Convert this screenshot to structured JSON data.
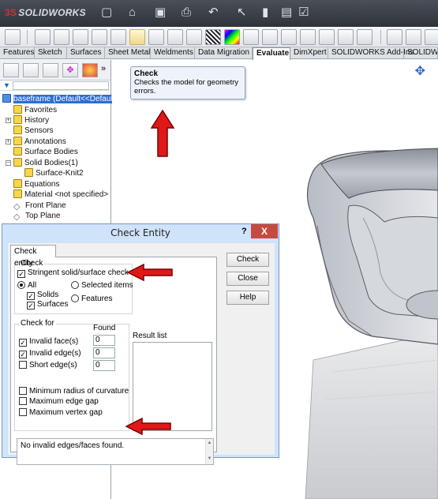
{
  "app": {
    "logo_text": "SOLIDWORKS",
    "logo_prefix": "3S"
  },
  "tabs": [
    "Features",
    "Sketch",
    "Surfaces",
    "Sheet Metal",
    "Weldments",
    "Data Migration",
    "Evaluate",
    "DimXpert",
    "SOLIDWORKS Add-Ins",
    "SOLIDWOR"
  ],
  "active_tab": "Evaluate",
  "tooltip": {
    "title": "Check",
    "body": "Checks the model for geometry errors."
  },
  "tree": {
    "root": "baseframe  (Default<<Default>",
    "items": [
      {
        "label": "Favorites"
      },
      {
        "label": "History"
      },
      {
        "label": "Sensors"
      },
      {
        "label": "Annotations"
      },
      {
        "label": "Surface Bodies"
      },
      {
        "label": "Solid Bodies(1)"
      },
      {
        "label": "Surface-Knit2"
      },
      {
        "label": "Equations"
      },
      {
        "label": "Material <not specified>"
      },
      {
        "label": "Front Plane"
      },
      {
        "label": "Top Plane"
      }
    ]
  },
  "dialog": {
    "title": "Check Entity",
    "help": "?",
    "close": "X",
    "tab_label": "Check entity",
    "check_group": "Check",
    "stringent": "Stringent solid/surface check",
    "all": "All",
    "selected_items": "Selected items",
    "solids": "Solids",
    "surfaces": "Surfaces",
    "features": "Features",
    "check_for_group": "Check for",
    "found_header": "Found",
    "invalid_faces": "Invalid face(s)",
    "invalid_edges": "Invalid edge(s)",
    "short_edges": "Short edge(s)",
    "invalid_faces_count": "0",
    "invalid_edges_count": "0",
    "short_edges_count": "0",
    "min_radius": "Minimum radius of curvature",
    "max_edge_gap": "Maximum edge gap",
    "max_vertex_gap": "Maximum vertex gap",
    "result_list": "Result list",
    "status": "No invalid edges/faces found.",
    "btn_check": "Check",
    "btn_close": "Close",
    "btn_help": "Help"
  },
  "colors": {
    "arrow": "#e01818",
    "selection": "#2f6cd2",
    "dialog_frame": "#cfe3fa"
  }
}
